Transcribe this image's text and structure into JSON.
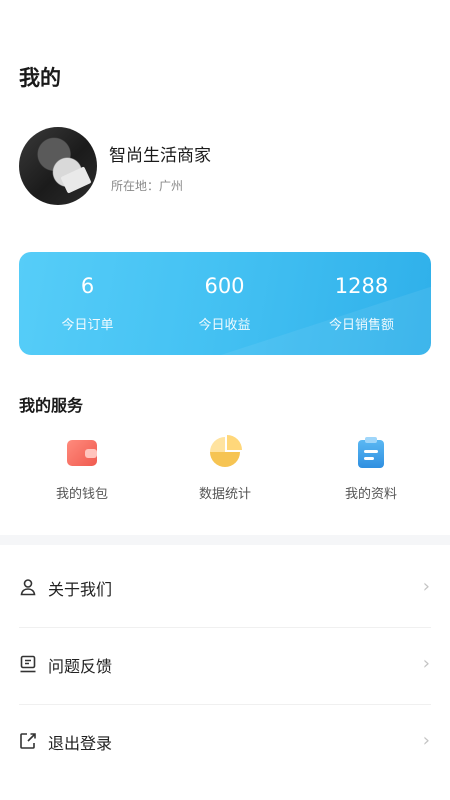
{
  "header": {
    "title": "我的"
  },
  "profile": {
    "name": "智尚生活商家",
    "location": "所在地：广州"
  },
  "stats": [
    {
      "value": "6",
      "label": "今日订单"
    },
    {
      "value": "600",
      "label": "今日收益"
    },
    {
      "value": "1288",
      "label": "今日销售额"
    }
  ],
  "services": {
    "title": "我的服务",
    "items": [
      {
        "label": "我的钱包",
        "icon": "wallet-icon"
      },
      {
        "label": "数据统计",
        "icon": "pie-chart-icon"
      },
      {
        "label": "我的资料",
        "icon": "clipboard-icon"
      }
    ]
  },
  "menu": [
    {
      "label": "关于我们",
      "icon": "user-icon"
    },
    {
      "label": "问题反馈",
      "icon": "feedback-icon"
    },
    {
      "label": "退出登录",
      "icon": "logout-icon"
    }
  ],
  "colors": {
    "accent_start": "#56cdf8",
    "accent_end": "#2fb0ea"
  }
}
